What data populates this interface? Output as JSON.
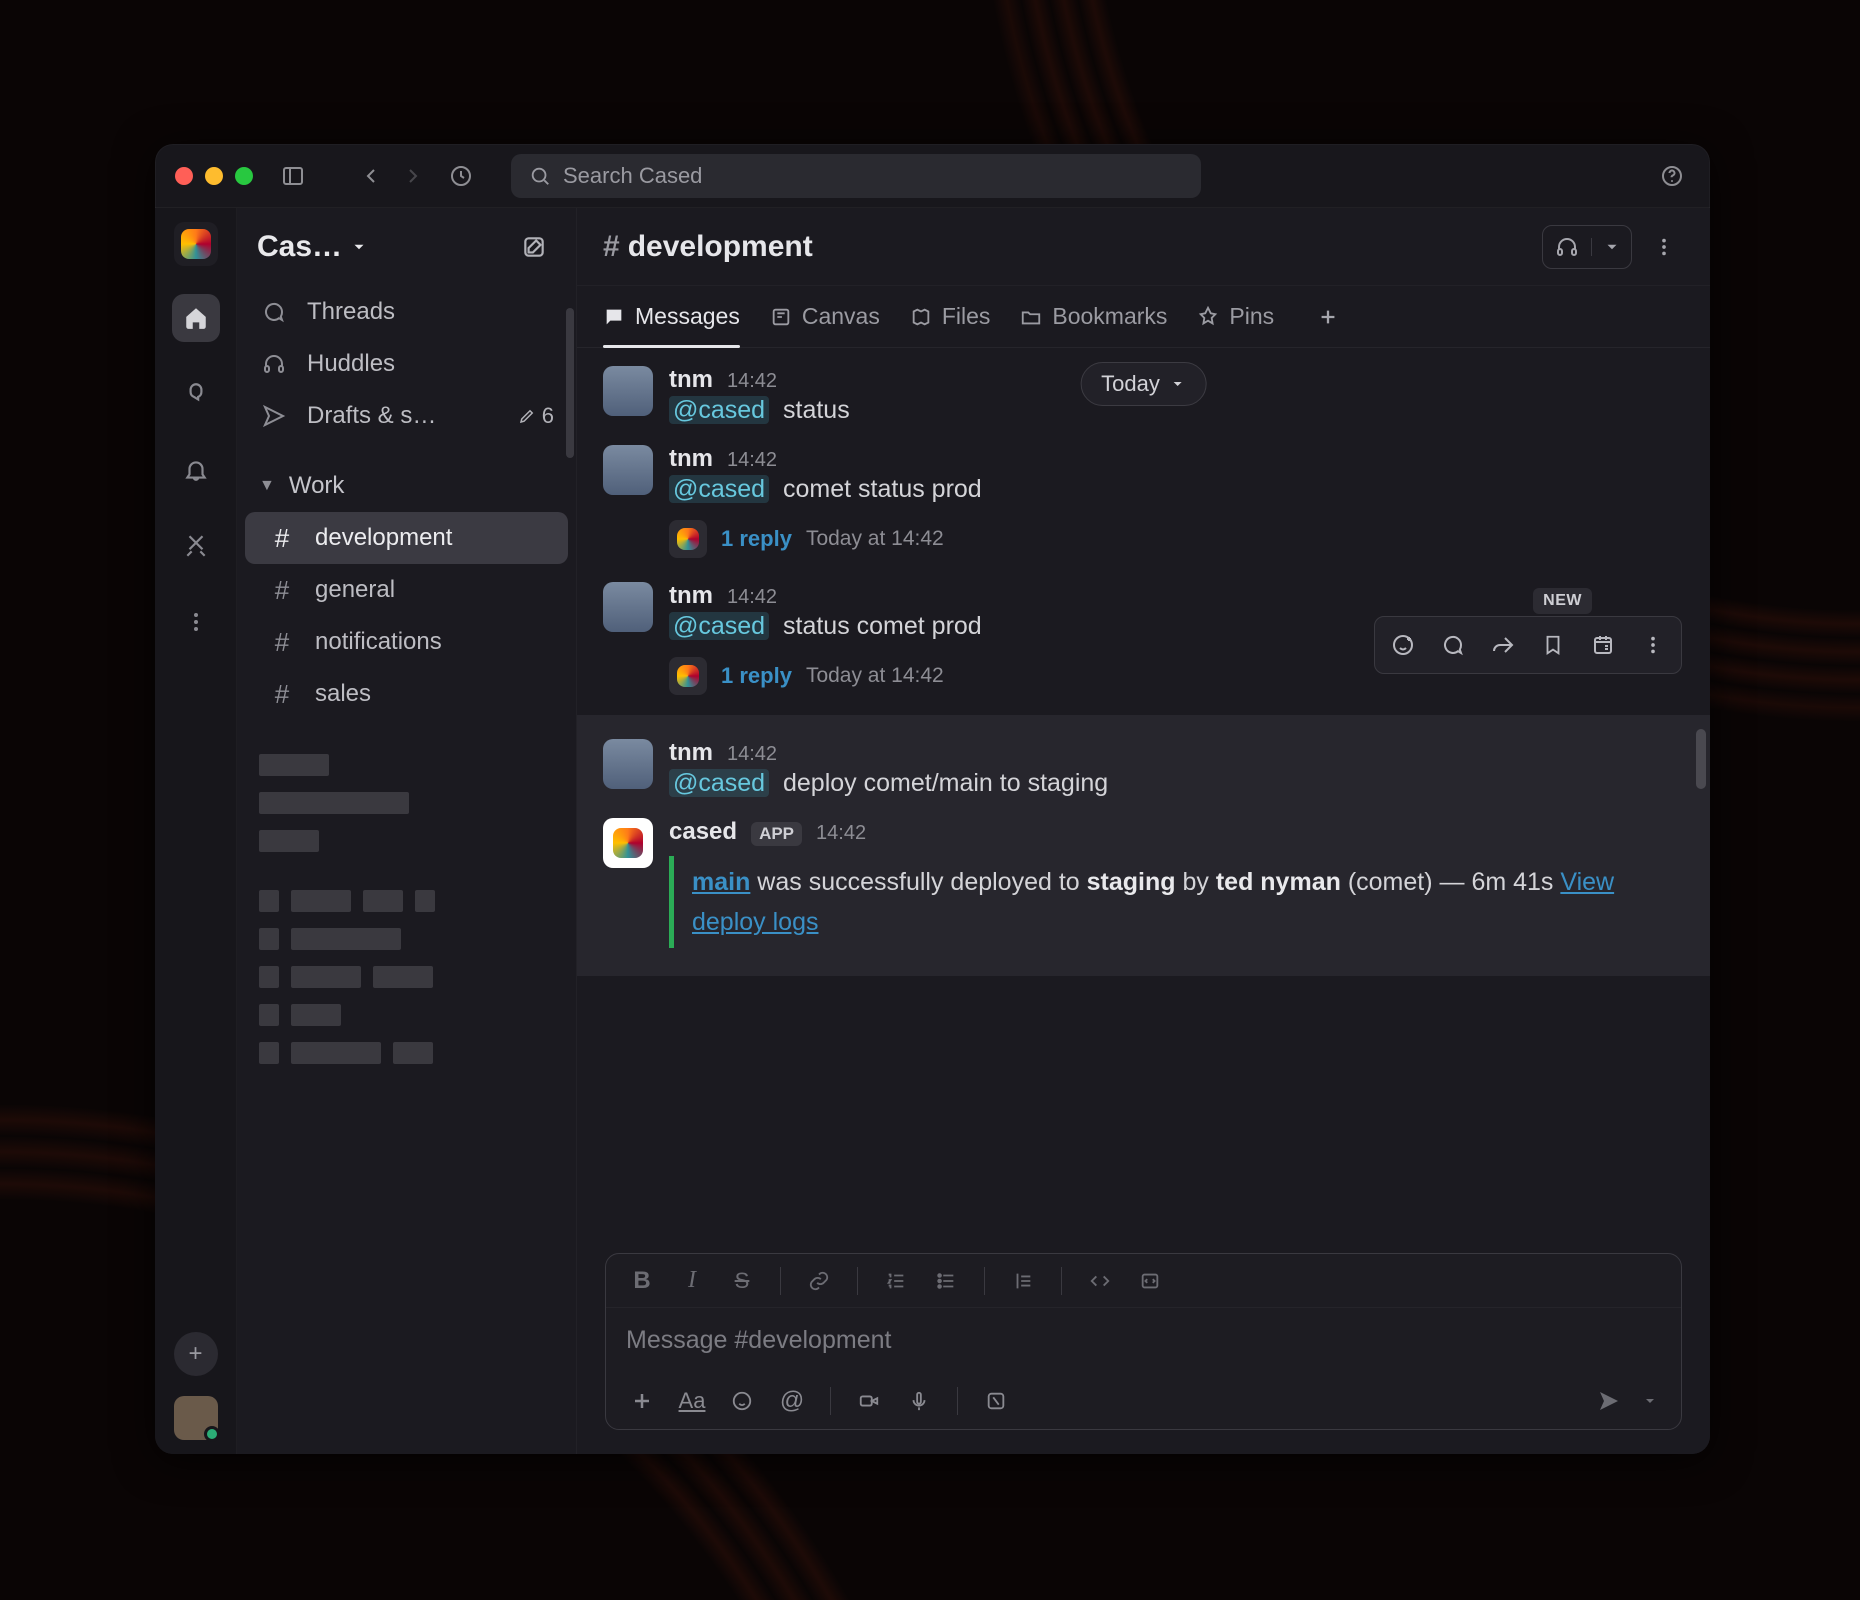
{
  "search": {
    "placeholder": "Search Cased"
  },
  "workspace": {
    "name": "Cas…"
  },
  "sidebar": {
    "threads": "Threads",
    "huddles": "Huddles",
    "drafts": "Drafts & s…",
    "drafts_count": "6",
    "section_label": "Work",
    "channels": [
      {
        "name": "development",
        "active": true
      },
      {
        "name": "general",
        "active": false
      },
      {
        "name": "notifications",
        "active": false
      },
      {
        "name": "sales",
        "active": false
      }
    ]
  },
  "channel": {
    "name": "development",
    "tabs": [
      "Messages",
      "Canvas",
      "Files",
      "Bookmarks",
      "Pins"
    ],
    "active_tab": 0,
    "date_label": "Today"
  },
  "mention": "@cased",
  "messages": [
    {
      "author": "tnm",
      "time": "14:42",
      "text": "status"
    },
    {
      "author": "tnm",
      "time": "14:42",
      "text": "comet status prod",
      "thread": {
        "replies_label": "1 reply",
        "time": "Today at 14:42"
      }
    },
    {
      "author": "tnm",
      "time": "14:42",
      "text": "status comet prod",
      "thread": {
        "replies_label": "1 reply",
        "time": "Today at 14:42"
      }
    },
    {
      "author": "tnm",
      "time": "14:42",
      "text": "deploy comet/main to staging"
    }
  ],
  "app_message": {
    "author": "cased",
    "badge": "APP",
    "time": "14:42",
    "branch": "main",
    "mid": " was successfully deployed to ",
    "target": "staging",
    "by_word": " by ",
    "actor": "ted nyman",
    "tail": " (comet) — 6m 41s ",
    "link": "View deploy logs"
  },
  "hover_badge": "NEW",
  "composer": {
    "placeholder": "Message #development"
  }
}
